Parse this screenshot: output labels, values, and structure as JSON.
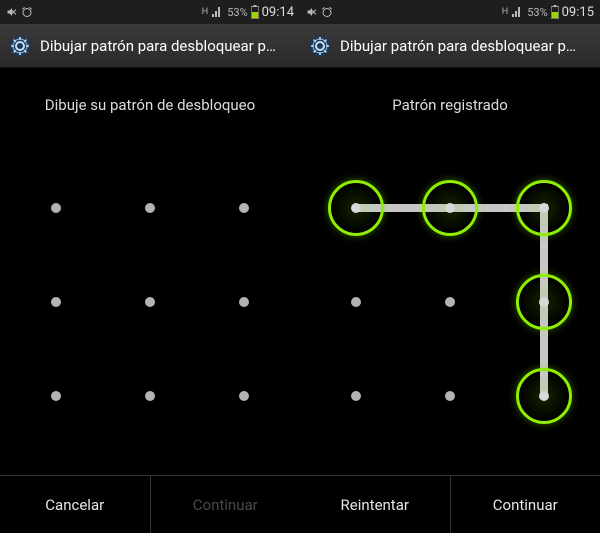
{
  "left": {
    "status": {
      "battery_percent": "53%",
      "time": "09:14"
    },
    "title": "Dibujar patrón para desbloquear p…",
    "prompt": "Dibuje su patrón de desbloqueo",
    "pattern": {
      "active_nodes": [],
      "path": []
    },
    "buttons": {
      "cancel": "Cancelar",
      "continue": "Continuar",
      "continue_enabled": false
    }
  },
  "right": {
    "status": {
      "battery_percent": "53%",
      "time": "09:15"
    },
    "title": "Dibujar patrón para desbloquear p…",
    "prompt": "Patrón registrado",
    "pattern": {
      "active_nodes": [
        0,
        1,
        2,
        5,
        8
      ],
      "path": [
        0,
        1,
        2,
        5,
        8
      ]
    },
    "buttons": {
      "retry": "Reintentar",
      "continue": "Continuar",
      "continue_enabled": true
    }
  },
  "colors": {
    "accent": "#8ef000",
    "line": "#c7c7c7"
  }
}
